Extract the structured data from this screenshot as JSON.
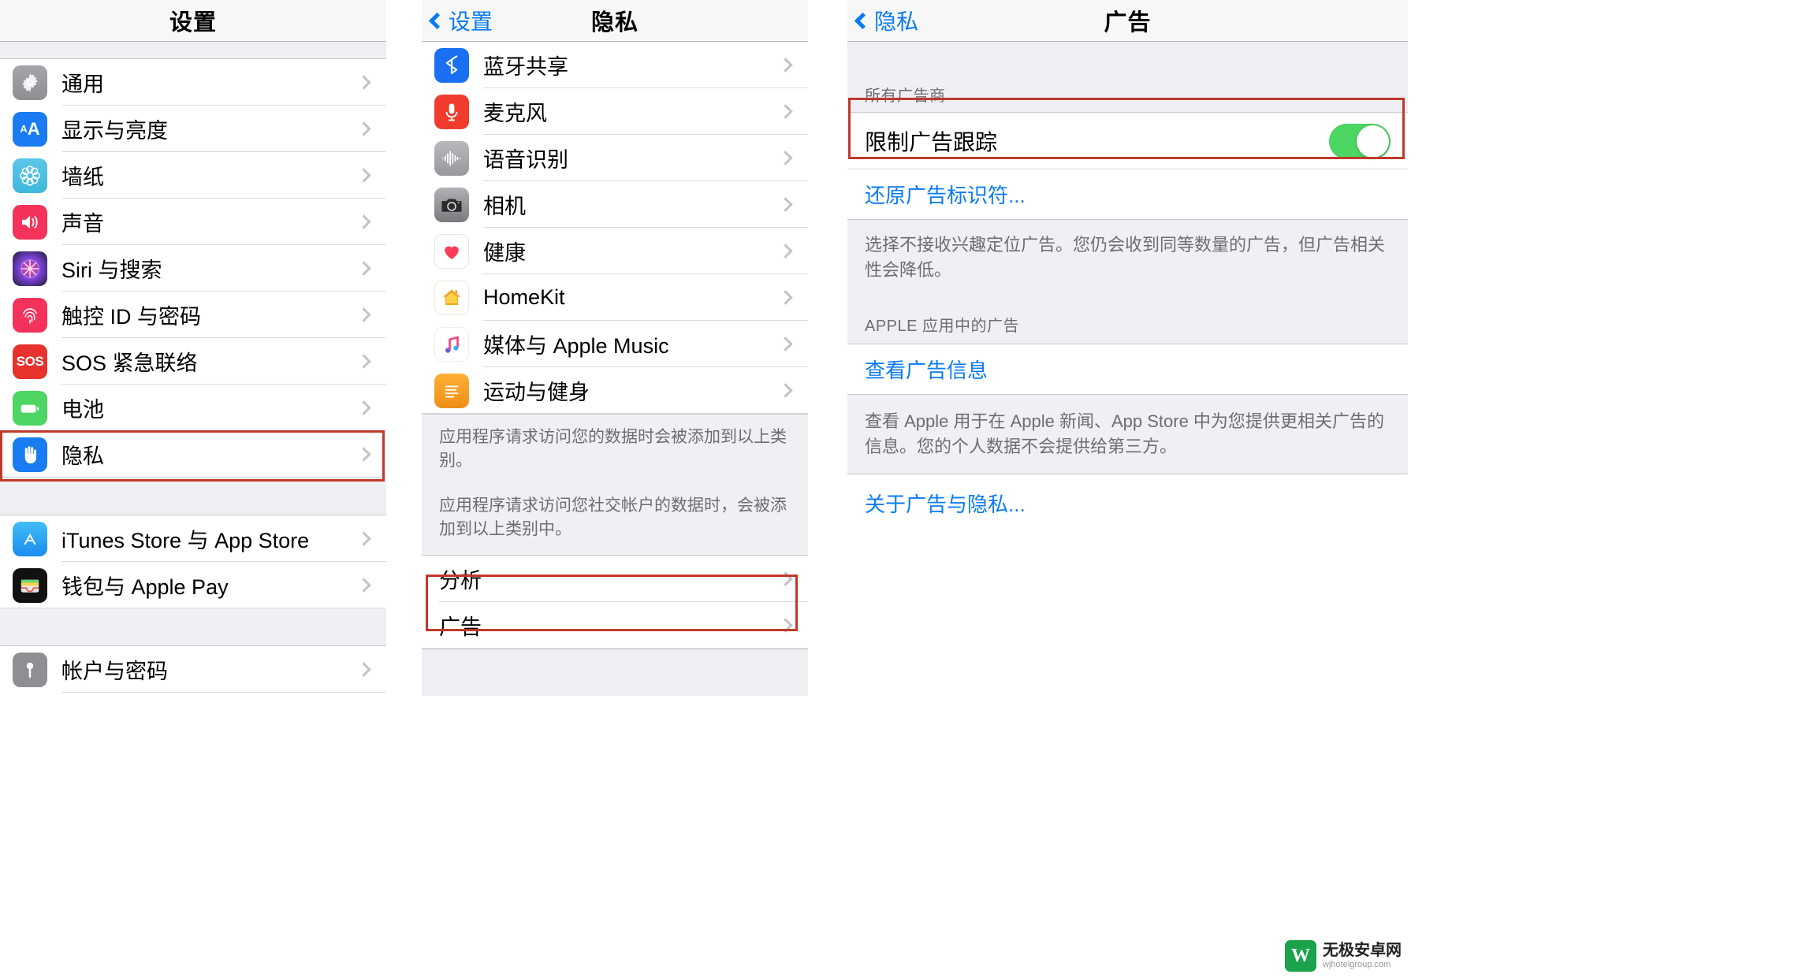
{
  "settings_screen": {
    "nav_title": "设置",
    "groups": [
      {
        "items": [
          {
            "label": "通用",
            "icon": "gear-icon"
          },
          {
            "label": "显示与亮度",
            "icon": "display-brightness-icon"
          },
          {
            "label": "墙纸",
            "icon": "wallpaper-icon"
          },
          {
            "label": "声音",
            "icon": "sound-icon"
          },
          {
            "label": "Siri 与搜索",
            "icon": "siri-icon"
          },
          {
            "label": "触控 ID 与密码",
            "icon": "touch-id-icon"
          },
          {
            "label": "SOS 紧急联络",
            "icon": "sos-icon"
          },
          {
            "label": "电池",
            "icon": "battery-icon"
          },
          {
            "label": "隐私",
            "icon": "privacy-hand-icon"
          }
        ]
      },
      {
        "items": [
          {
            "label": "iTunes Store 与 App Store",
            "icon": "app-store-icon"
          },
          {
            "label": "钱包与 Apple Pay",
            "icon": "wallet-icon"
          }
        ]
      },
      {
        "items": [
          {
            "label": "帐户与密码",
            "icon": "accounts-passwords-icon"
          }
        ]
      }
    ]
  },
  "privacy_screen": {
    "nav_back_label": "设置",
    "nav_title": "隐私",
    "items": [
      {
        "label": "蓝牙共享",
        "icon": "bluetooth-icon"
      },
      {
        "label": "麦克风",
        "icon": "microphone-icon"
      },
      {
        "label": "语音识别",
        "icon": "speech-recognition-icon"
      },
      {
        "label": "相机",
        "icon": "camera-icon"
      },
      {
        "label": "健康",
        "icon": "health-heart-icon"
      },
      {
        "label": "HomeKit",
        "icon": "homekit-icon"
      },
      {
        "label": "媒体与 Apple Music",
        "icon": "music-icon"
      },
      {
        "label": "运动与健身",
        "icon": "fitness-icon"
      }
    ],
    "footer_paragraph_1": "应用程序请求访问您的数据时会被添加到以上类别。",
    "footer_paragraph_2": "应用程序请求访问您社交帐户的数据时，会被添加到以上类别中。",
    "bottom_items": [
      {
        "label": "分析"
      },
      {
        "label": "广告"
      }
    ]
  },
  "advertising_screen": {
    "nav_back_label": "隐私",
    "nav_title": "广告",
    "section_header_all_advertisers": "所有广告商",
    "limit_ad_tracking_label": "限制广告跟踪",
    "limit_ad_tracking_state": "on",
    "reset_ad_id_link": "还原广告标识符...",
    "tracking_footer": "选择不接收兴趣定位广告。您仍会收到同等数量的广告，但广告相关性会降低。",
    "section_header_apple_ads": "APPLE 应用中的广告",
    "view_ad_info_link": "查看广告信息",
    "apple_ads_footer": "查看 Apple 用于在 Apple 新闻、App Store 中为您提供更相关广告的信息。您的个人数据不会提供给第三方。",
    "about_ads_privacy_link": "关于广告与隐私..."
  },
  "watermark": {
    "logo_letter": "W",
    "title": "无极安卓网",
    "subtitle": "wjhotelgroup.com"
  },
  "colors": {
    "accent_blue": "#0a7bf5",
    "toggle_green": "#4cd763",
    "highlight_red": "#c0392b",
    "group_background": "#efeff4"
  }
}
